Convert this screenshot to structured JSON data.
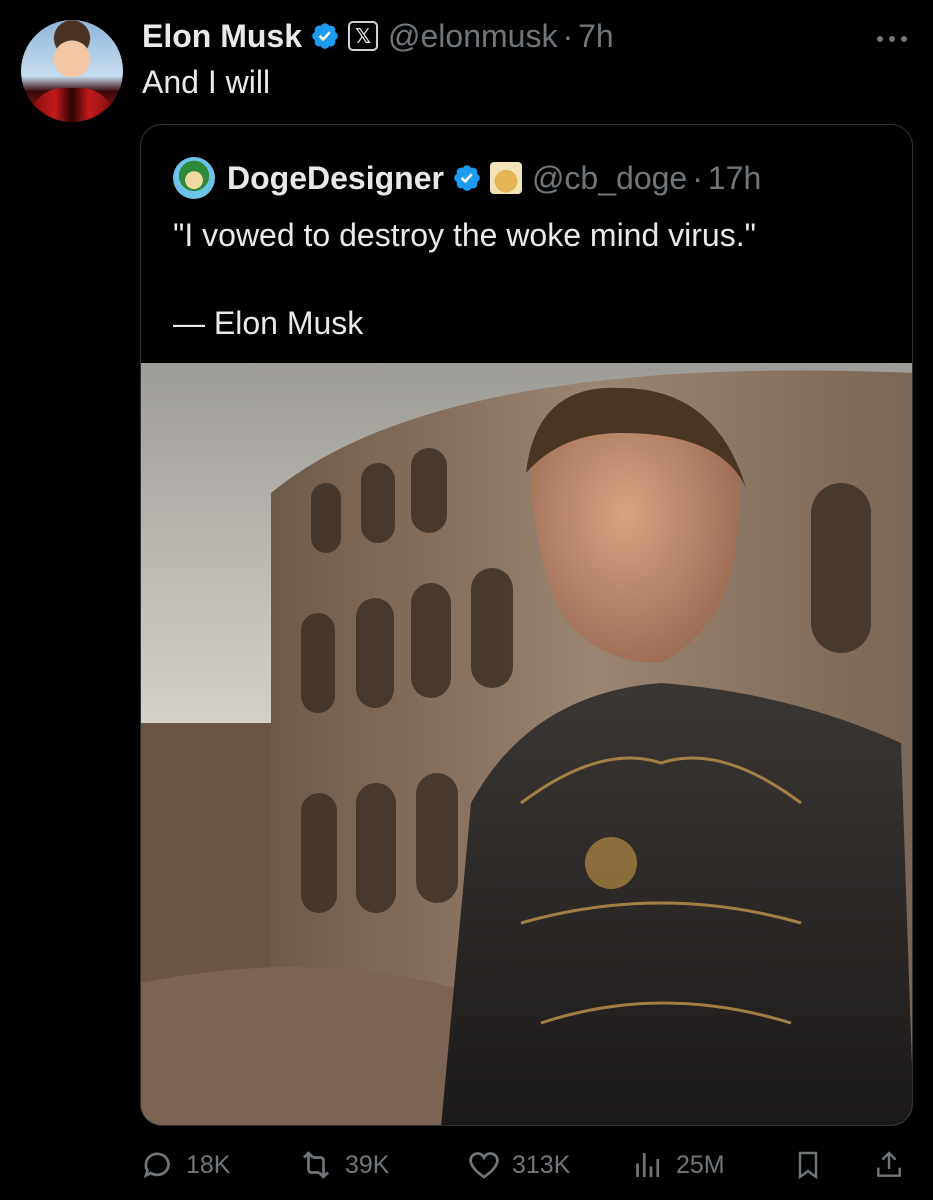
{
  "post": {
    "author_name": "Elon Musk",
    "handle": "@elonmusk",
    "separator": "·",
    "time": "7h",
    "text": "And I will",
    "verified": true,
    "affiliation_badge": "𝕏"
  },
  "quoted": {
    "author_name": "DogeDesigner",
    "handle": "@cb_doge",
    "separator": "·",
    "time": "17h",
    "lines": [
      "\"I vowed to destroy the woke mind virus.\"",
      "",
      "— Elon Musk"
    ],
    "verified": true
  },
  "actions": {
    "replies": "18K",
    "reposts": "39K",
    "likes": "313K",
    "views": "25M"
  },
  "colors": {
    "background": "#000000",
    "text_primary": "#e7e9ea",
    "text_secondary": "#71767b",
    "verified_blue": "#1d9bf0",
    "border": "#2f3336"
  },
  "icons": {
    "more": "more-horizontal-icon",
    "reply": "reply-icon",
    "repost": "repost-icon",
    "like": "heart-icon",
    "views": "views-icon",
    "bookmark": "bookmark-icon",
    "share": "share-icon"
  }
}
